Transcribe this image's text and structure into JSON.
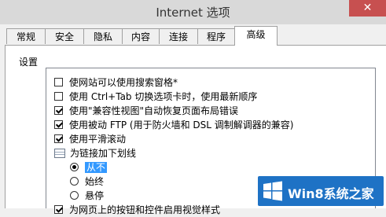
{
  "window": {
    "title": "Internet 选项",
    "close_glyph": "✕"
  },
  "tabs": [
    {
      "label": "常规"
    },
    {
      "label": "安全"
    },
    {
      "label": "隐私"
    },
    {
      "label": "内容"
    },
    {
      "label": "连接"
    },
    {
      "label": "程序"
    },
    {
      "label": "高级",
      "active": true
    }
  ],
  "settings": {
    "group_label": "设置",
    "items": [
      {
        "label": "使网站可以使用搜索窗格*",
        "type": "checkbox",
        "checked": false
      },
      {
        "label": "使用 Ctrl+Tab 切换选项卡时，使用最新顺序",
        "type": "checkbox",
        "checked": false
      },
      {
        "label": "使用\"兼容性视图\"自动恢复页面布局错误",
        "type": "checkbox",
        "checked": true
      },
      {
        "label": "使用被动 FTP (用于防火墙和 DSL 调制解调器的兼容)",
        "type": "checkbox",
        "checked": true
      },
      {
        "label": "使用平滑滚动",
        "type": "checkbox",
        "checked": true
      },
      {
        "label": "为链接加下划线",
        "type": "group",
        "icon": "settings-group-icon"
      },
      {
        "label": "从不",
        "type": "radio",
        "selected": true
      },
      {
        "label": "始终",
        "type": "radio",
        "selected": false
      },
      {
        "label": "悬停",
        "type": "radio",
        "selected": false
      },
      {
        "label": "为网页上的按钮和控件启用视觉样式",
        "type": "checkbox",
        "checked": true
      }
    ]
  },
  "watermark": {
    "text": "Win8系统之家",
    "color": "#1e72c5"
  }
}
